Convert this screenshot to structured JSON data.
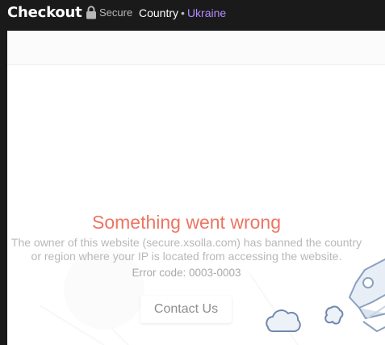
{
  "header": {
    "title": "Checkout",
    "secure_label": "Secure",
    "country_label": "Country",
    "separator": "•",
    "country_value": "Ukraine",
    "accent_color": "#b08cff"
  },
  "error": {
    "title": "Something went wrong",
    "message": "The owner of this website (secure.xsolla.com) has banned the country or region where your IP is located from accessing the website.",
    "code": "Error code: 0003-0003",
    "title_color": "#ee7462"
  },
  "actions": {
    "contact_label": "Contact Us"
  },
  "icons": {
    "lock": "lock-icon",
    "rocket": "rocket-illustration",
    "clouds": "cloud-icon"
  }
}
